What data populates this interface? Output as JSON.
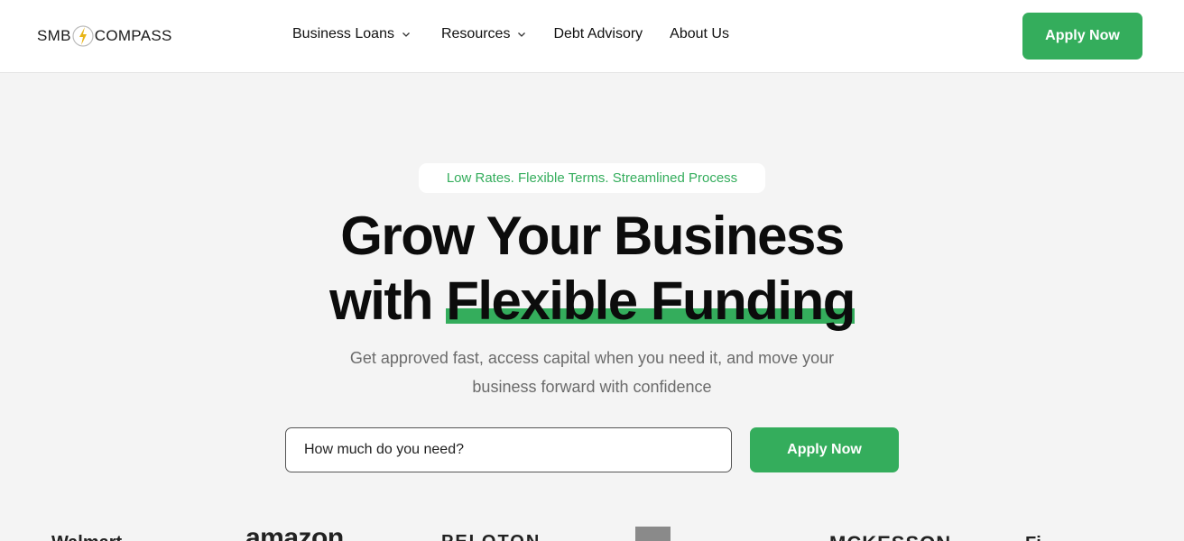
{
  "header": {
    "logo": {
      "text_left": "SMB",
      "text_right": "COMPASS",
      "mark_icon": "compass-bolt-icon"
    },
    "nav": [
      {
        "label": "Business Loans",
        "has_dropdown": true
      },
      {
        "label": "Resources",
        "has_dropdown": true
      },
      {
        "label": "Debt Advisory",
        "has_dropdown": false
      },
      {
        "label": "About Us",
        "has_dropdown": false
      }
    ],
    "apply_label": "Apply Now"
  },
  "hero": {
    "tagline": "Low Rates. Flexible Terms. Streamlined Process",
    "headline_line1": "Grow Your Business",
    "headline_line2_prefix": "with ",
    "headline_line2_highlight": "Flexible Funding",
    "subtitle": "Get approved fast, access capital when you need it, and move your business forward with confidence",
    "amount_placeholder": "How much do you need?",
    "apply_label": "Apply Now"
  },
  "brands": [
    "Walmart",
    "amazon",
    "PELOTON",
    "",
    "MCKESSON",
    "Fi"
  ],
  "colors": {
    "accent": "#34ad5c",
    "background": "#f4f4f4",
    "header_bg": "#ffffff",
    "text": "#111111",
    "muted": "#6b6b6b"
  }
}
